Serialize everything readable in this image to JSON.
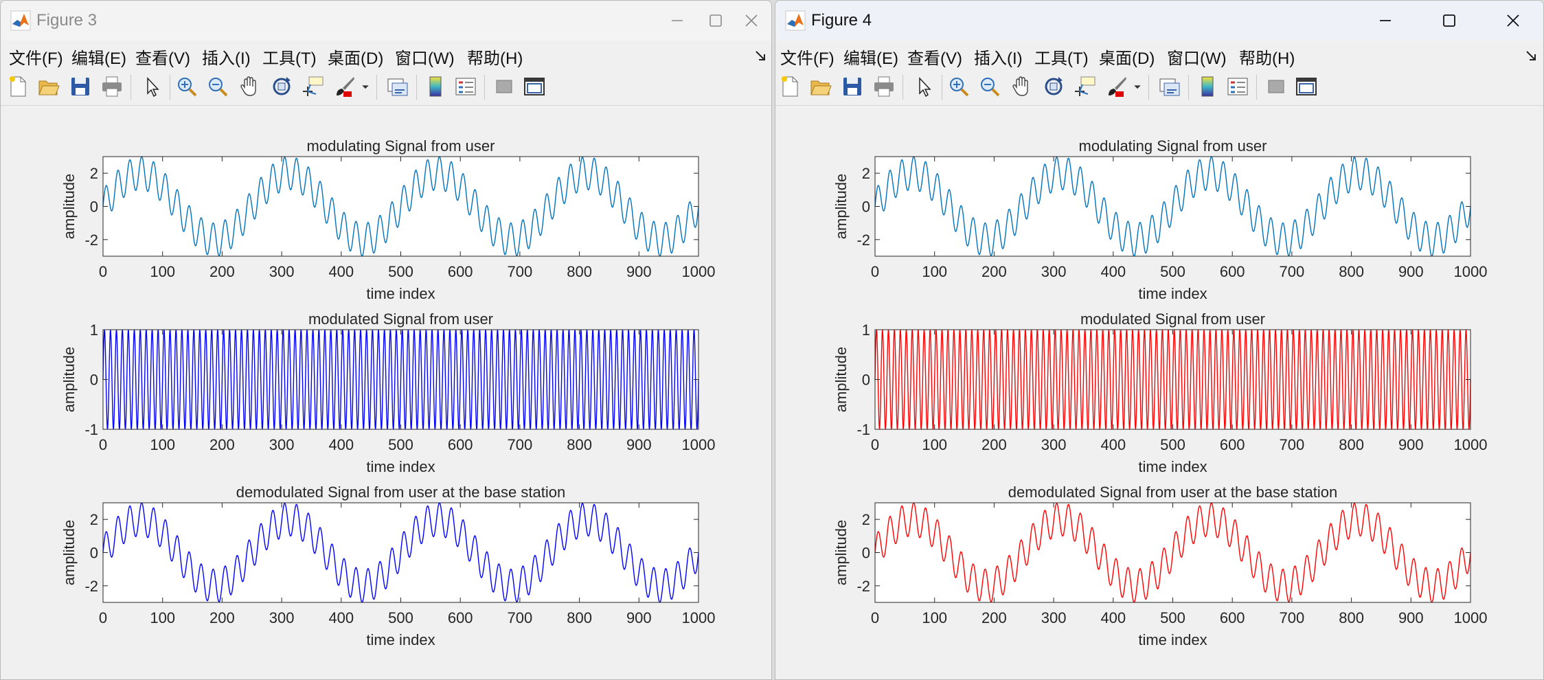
{
  "windows": [
    {
      "title": "Figure 3",
      "active": false,
      "plot_color": "#0072BD",
      "menu": [
        "文件(F)",
        "编辑(E)",
        "查看(V)",
        "插入(I)",
        "工具(T)",
        "桌面(D)",
        "窗口(W)",
        "帮助(H)"
      ]
    },
    {
      "title": "Figure 4",
      "active": true,
      "plot_color": "#FF0000",
      "menu": [
        "文件(F)",
        "编辑(E)",
        "查看(V)",
        "插入(I)",
        "工具(T)",
        "桌面(D)",
        "窗口(W)",
        "帮助(H)"
      ]
    }
  ],
  "toolbar_icons": [
    "new-figure-icon",
    "open-file-icon",
    "save-icon",
    "print-icon",
    "select-arrow-icon",
    "zoom-in-icon",
    "zoom-out-icon",
    "pan-hand-icon",
    "rotate-3d-icon",
    "data-cursor-icon",
    "brush-icon",
    "brush-dropdown-icon",
    "link-plot-icon",
    "colorbar-icon",
    "legend-icon",
    "hide-plot-tools-icon",
    "show-plot-tools-icon"
  ],
  "chart_data": [
    {
      "window": "Figure 3",
      "type": "line",
      "title": "modulating Signal from user",
      "xlabel": "time index",
      "ylabel": "amplitude",
      "xlim": [
        0,
        1000
      ],
      "ylim": [
        -3,
        3
      ],
      "xticks": [
        "0",
        "100",
        "200",
        "300",
        "400",
        "500",
        "600",
        "700",
        "800",
        "900",
        "1000"
      ],
      "yticks": [
        "2",
        "0",
        "-2"
      ],
      "series": [
        {
          "color": "#0072BD",
          "components": [
            {
              "amp": 2,
              "period": 250
            },
            {
              "amp": 1,
              "period": 20
            }
          ]
        }
      ]
    },
    {
      "window": "Figure 3",
      "type": "line",
      "title": "modulated Signal from user",
      "xlabel": "time index",
      "ylabel": "amplitude",
      "xlim": [
        0,
        1000
      ],
      "ylim": [
        -1,
        1
      ],
      "xticks": [
        "0",
        "100",
        "200",
        "300",
        "400",
        "500",
        "600",
        "700",
        "800",
        "900",
        "1000"
      ],
      "yticks": [
        "1",
        "0",
        "-1"
      ],
      "series": [
        {
          "color": "#0000FF",
          "components": [
            {
              "amp": 1,
              "period": 10
            }
          ]
        }
      ]
    },
    {
      "window": "Figure 3",
      "type": "line",
      "title": "demodulated Signal from user at the base station",
      "xlabel": "time index",
      "ylabel": "amplitude",
      "xlim": [
        0,
        1000
      ],
      "ylim": [
        -3,
        3
      ],
      "xticks": [
        "0",
        "100",
        "200",
        "300",
        "400",
        "500",
        "600",
        "700",
        "800",
        "900",
        "1000"
      ],
      "yticks": [
        "2",
        "0",
        "-2"
      ],
      "series": [
        {
          "color": "#0000FF",
          "components": [
            {
              "amp": 2,
              "period": 250
            },
            {
              "amp": 1,
              "period": 20
            }
          ]
        }
      ]
    },
    {
      "window": "Figure 4",
      "type": "line",
      "title": "modulating Signal from user",
      "xlabel": "time index",
      "ylabel": "amplitude",
      "xlim": [
        0,
        1000
      ],
      "ylim": [
        -3,
        3
      ],
      "xticks": [
        "0",
        "100",
        "200",
        "300",
        "400",
        "500",
        "600",
        "700",
        "800",
        "900",
        "1000"
      ],
      "yticks": [
        "2",
        "0",
        "-2"
      ],
      "series": [
        {
          "color": "#0072BD",
          "components": [
            {
              "amp": 2,
              "period": 250
            },
            {
              "amp": 1,
              "period": 20
            }
          ]
        }
      ]
    },
    {
      "window": "Figure 4",
      "type": "line",
      "title": "modulated Signal from user",
      "xlabel": "time index",
      "ylabel": "amplitude",
      "xlim": [
        0,
        1000
      ],
      "ylim": [
        -1,
        1
      ],
      "xticks": [
        "0",
        "100",
        "200",
        "300",
        "400",
        "500",
        "600",
        "700",
        "800",
        "900",
        "1000"
      ],
      "yticks": [
        "1",
        "0",
        "-1"
      ],
      "series": [
        {
          "color": "#FF0000",
          "components": [
            {
              "amp": 1,
              "period": 10
            }
          ]
        }
      ]
    },
    {
      "window": "Figure 4",
      "type": "line",
      "title": "demodulated Signal from user at the base station",
      "xlabel": "time index",
      "ylabel": "amplitude",
      "xlim": [
        0,
        1000
      ],
      "ylim": [
        -3,
        3
      ],
      "xticks": [
        "0",
        "100",
        "200",
        "300",
        "400",
        "500",
        "600",
        "700",
        "800",
        "900",
        "1000"
      ],
      "yticks": [
        "2",
        "0",
        "-2"
      ],
      "series": [
        {
          "color": "#FF0000",
          "components": [
            {
              "amp": 2,
              "period": 250
            },
            {
              "amp": 1,
              "period": 20
            }
          ]
        }
      ]
    }
  ]
}
